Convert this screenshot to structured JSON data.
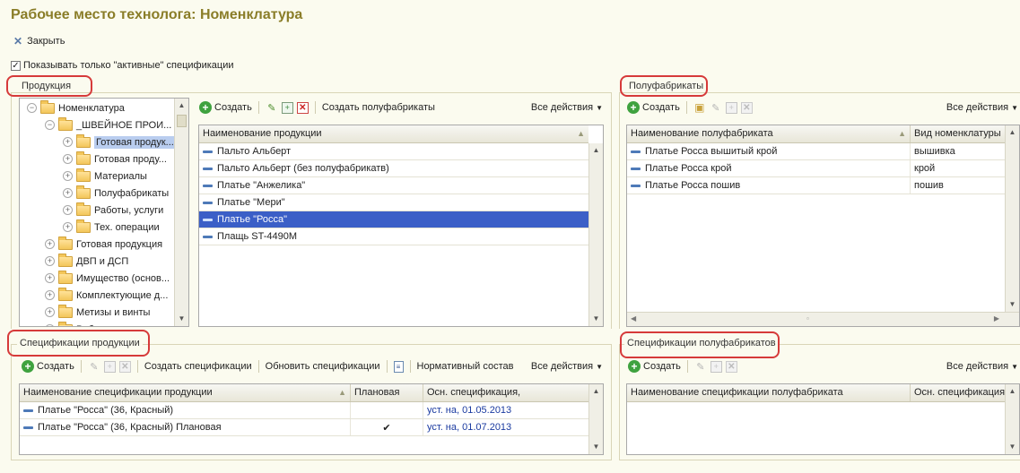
{
  "window": {
    "title": "Рабочее место технолога: Номенклатура"
  },
  "toolbar": {
    "close_label": "Закрыть"
  },
  "filter": {
    "active_only_label": "Показывать только \"активные\" спецификации",
    "active_only_checked": true
  },
  "products": {
    "group_label": "Продукция",
    "tree": [
      {
        "label": "Номенклатура",
        "level": 0,
        "expanded": true
      },
      {
        "label": "_ШВЕЙНОЕ ПРОИ...",
        "level": 1,
        "expanded": true
      },
      {
        "label": "Готовая продук...",
        "level": 2,
        "selected": true
      },
      {
        "label": "Готовая проду...",
        "level": 2
      },
      {
        "label": "Материалы",
        "level": 2
      },
      {
        "label": "Полуфабрикаты",
        "level": 2
      },
      {
        "label": "Работы, услуги",
        "level": 2
      },
      {
        "label": "Тех. операции",
        "level": 2
      },
      {
        "label": "Готовая продукция",
        "level": 1
      },
      {
        "label": "ДВП и ДСП",
        "level": 1
      },
      {
        "label": "Имущество (основ...",
        "level": 1
      },
      {
        "label": "Комплектующие д...",
        "level": 1
      },
      {
        "label": "Метизы и винты",
        "level": 1
      },
      {
        "label": "Работы",
        "level": 1
      }
    ],
    "toolbar": {
      "create": "Создать",
      "create_semi": "Создать полуфабрикаты",
      "all_actions": "Все действия"
    },
    "table": {
      "header": "Наименование продукции",
      "rows": [
        "Пальто Альберт",
        "Пальто Альберт (без полуфабрикатв)",
        "Платье \"Анжелика\"",
        "Платье \"Мери\"",
        "Платье \"Росса\"",
        "Плащь ST-4490M"
      ],
      "selected_index": 4
    }
  },
  "semi": {
    "group_label": "Полуфабрикаты",
    "toolbar": {
      "create": "Создать",
      "all_actions": "Все действия"
    },
    "table": {
      "headers": [
        "Наименование полуфабриката",
        "Вид номенклатуры"
      ],
      "rows": [
        [
          "Платье Росса вышитый крой",
          "вышивка"
        ],
        [
          "Платье Росса крой",
          "крой"
        ],
        [
          "Платье Росса пошив",
          "пошив"
        ]
      ]
    }
  },
  "product_specs": {
    "group_label": "Спецификации продукции",
    "toolbar": {
      "create": "Создать",
      "create_specs": "Создать спецификации",
      "update_specs": "Обновить спецификации",
      "norm": "Нормативный состав",
      "all_actions": "Все действия"
    },
    "table": {
      "headers": [
        "Наименование спецификации продукции",
        "Плановая",
        "Осн. спецификация,"
      ],
      "rows": [
        {
          "name": "Платье \"Росса\" (36, Красный)",
          "planned": "",
          "main": "уст. на, 01.05.2013"
        },
        {
          "name": "Платье \"Росса\" (36, Красный) Плановая",
          "planned": "✔",
          "main": "уст. на, 01.07.2013"
        }
      ]
    }
  },
  "semi_specs": {
    "group_label": "Спецификации полуфабрикатов",
    "toolbar": {
      "create": "Создать",
      "all_actions": "Все действия"
    },
    "table": {
      "headers": [
        "Наименование спецификации полуфабриката",
        "Осн. спецификация"
      ]
    }
  }
}
